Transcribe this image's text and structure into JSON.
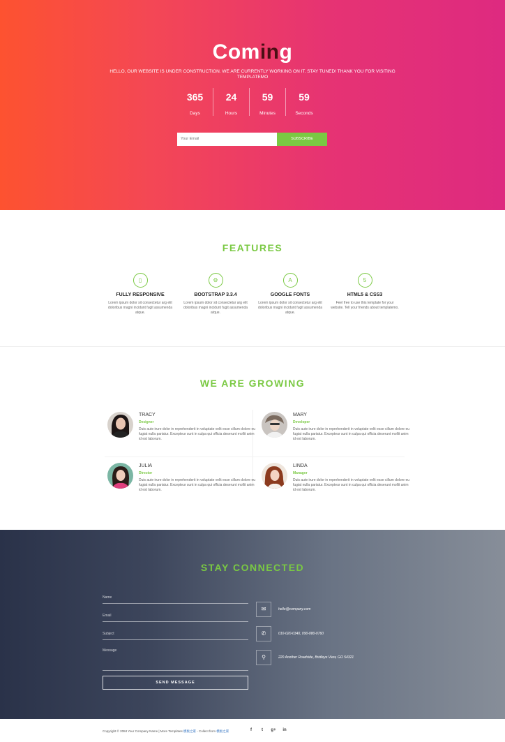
{
  "hero": {
    "title_start": "Com",
    "title_accent": "in",
    "title_end": "g",
    "tagline": "HELLO, OUR WEBSITE IS UNDER CONSTRUCTION. WE ARE CURRENTLY WORKING ON IT. STAY TUNED! THANK YOU FOR VISITING TEMPLATEMO",
    "countdown": [
      {
        "value": "365",
        "label": "Days"
      },
      {
        "value": "24",
        "label": "Hours"
      },
      {
        "value": "59",
        "label": "Minutes"
      },
      {
        "value": "59",
        "label": "Seconds"
      }
    ],
    "email_placeholder": "Your Email",
    "subscribe_label": "SUBSCRIBE"
  },
  "features": {
    "title": "FEATURES",
    "items": [
      {
        "icon": "mobile-icon",
        "glyph": "▯",
        "name": "FULLY RESPONSIVE",
        "desc": "Lorem ipsum dolor sit consectetur arg elit doloribus magni incidunt fugit assumenda atque."
      },
      {
        "icon": "cogs-icon",
        "glyph": "⚙",
        "name": "BOOTSTRAP 3.3.4",
        "desc": "Lorem ipsum dolor sit consectetur arg elit doloribus magni incidunt fugit assumenda atque."
      },
      {
        "icon": "font-icon",
        "glyph": "A",
        "name": "GOOGLE FONTS",
        "desc": "Lorem ipsum dolor sit consectetur arg elit doloribus magni incidunt fugit assumenda atque."
      },
      {
        "icon": "html5-icon",
        "glyph": "5",
        "name": "HTML5 & CSS3",
        "desc": "Feel free to use this template for your website. Tell your friends about templatemo."
      }
    ]
  },
  "growing": {
    "title": "WE ARE GROWING",
    "members": [
      {
        "name": "TRACY",
        "role": "Designer",
        "desc": "Duis aute irure dolor in reprehenderit in voluptate velit esse cillum dolore eu fugiat nulla pariatur. Excepteur sunt in culpa qui officia deserunt mollit anim id est laborum."
      },
      {
        "name": "MARY",
        "role": "Developer",
        "desc": "Duis aute irure dolor in reprehenderit in voluptate velit esse cillum dolore eu fugiat nulla pariatur. Excepteur sunt in culpa qui officia deserunt mollit anim id est laborum."
      },
      {
        "name": "JULIA",
        "role": "Director",
        "desc": "Duis aute irure dolor in reprehenderit in voluptate velit esse cillum dolore eu fugiat nulla pariatur. Excepteur sunt in culpa qui officia deserunt mollit anim id est laborum."
      },
      {
        "name": "LINDA",
        "role": "Manager",
        "desc": "Duis aute irure dolor in reprehenderit in voluptate velit esse cillum dolore eu fugiat nulla pariatur. Excepteur sunt in culpa qui officia deserunt mollit anim id est laborum."
      }
    ]
  },
  "contact": {
    "title": "STAY CONNECTED",
    "fields": {
      "name": "Name",
      "email": "Email",
      "subject": "Subject",
      "message": "Message"
    },
    "send_label": "SEND MESSAGE",
    "email": "hello@company.com",
    "phone": "010-020-0340, 090-080-0760",
    "address": "220 Another Roadside, Bridleye View, GO 54321"
  },
  "footer": {
    "copyright": "Copyright © 2084 Your Company Name | More Templates ",
    "link1": "模板之家",
    "collect": " - Collect from ",
    "link2": "模板之家",
    "social": [
      "f",
      "t",
      "g+",
      "in"
    ]
  },
  "colors": {
    "accent": "#7ac943",
    "hero_start": "#fd5230",
    "hero_end": "#de2a80",
    "contact_start": "#2a3249",
    "contact_end": "#878e99"
  }
}
